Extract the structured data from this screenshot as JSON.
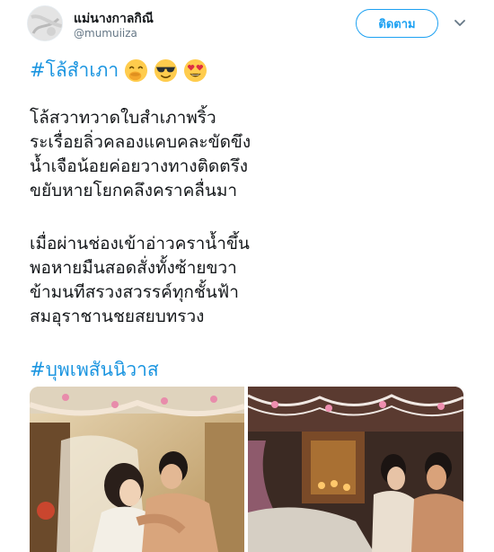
{
  "tweet": {
    "user": {
      "display_name": "แม่นางกาลกิณี",
      "handle": "@mumuiiza"
    },
    "follow_label": "ติดตาม",
    "hashtag_top": "#โล้สำเภา",
    "emojis": [
      "face-with-hand-over-mouth-emoji",
      "smiling-face-with-sunglasses-emoji",
      "smiling-face-with-heart-eyes-emoji"
    ],
    "stanza_1": [
      "โล้สวาทวาดใบสำเภาพริ้ว",
      "ระเรื่อยลิ่วคลองแคบคละขัดขึง",
      "น้ำเจือน้อยค่อยวางทางติดตรึง",
      "ขยับหายโยกคลึงคราคลื่นมา"
    ],
    "stanza_2": [
      "เมื่อผ่านช่องเข้าอ่าวคราน้ำขึ้น",
      "พอหายมืนสอดสั่งทั้งซ้ายขวา",
      "ข้ามนทีสรวงสวรรค์ทุกชั้นฟ้า",
      "สมอุราชานชยสยบทรวง"
    ],
    "hashtag_bottom": "#บุพเพสันนิวาส",
    "colors": {
      "link": "#1b95e0",
      "follow": "#1da1f2",
      "text": "#14171a",
      "muted": "#657786"
    }
  }
}
